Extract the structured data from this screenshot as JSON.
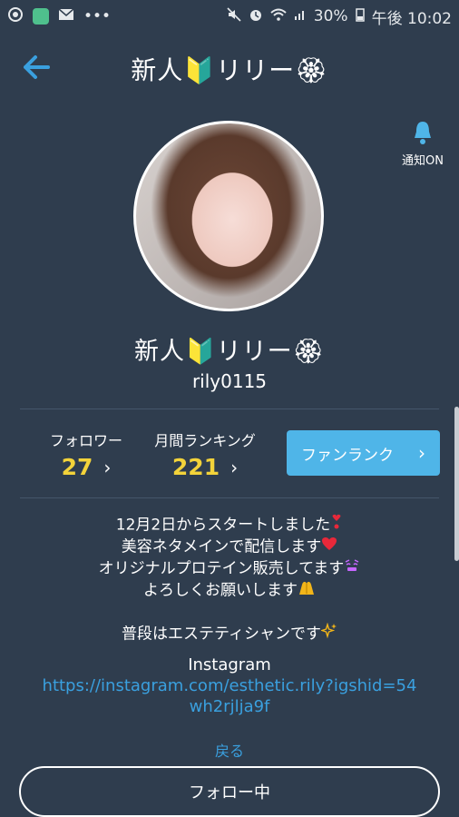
{
  "status_bar": {
    "battery": "30%",
    "time": "午後 10:02"
  },
  "header": {
    "title": "新人🔰リリー🏵"
  },
  "notify": {
    "label": "通知ON"
  },
  "profile": {
    "name": "新人🔰リリー🏵",
    "user_id": "rily0115"
  },
  "stats": {
    "followers_label": "フォロワー",
    "followers_value": "27",
    "ranking_label": "月間ランキング",
    "ranking_value": "221"
  },
  "fan_rank": {
    "label": "ファンランク"
  },
  "bio": {
    "lines": [
      "12月2日からスタートしました",
      "美容ネタメインで配信します",
      "オリジナルプロテイン販売してます",
      "よろしくお願いします",
      "",
      "普段はエステティシャンです"
    ],
    "instagram_label": "Instagram",
    "instagram_url": "https://instagram.com/esthetic.rily?igshid=54wh2rjlja9f"
  },
  "back_label": "戻る",
  "follow_button": {
    "label": "フォロー中"
  },
  "colors": {
    "background": "#2f3d4e",
    "accent": "#3aa0df",
    "stat_value": "#f3d33a",
    "fan_button": "#4fb5e8"
  }
}
